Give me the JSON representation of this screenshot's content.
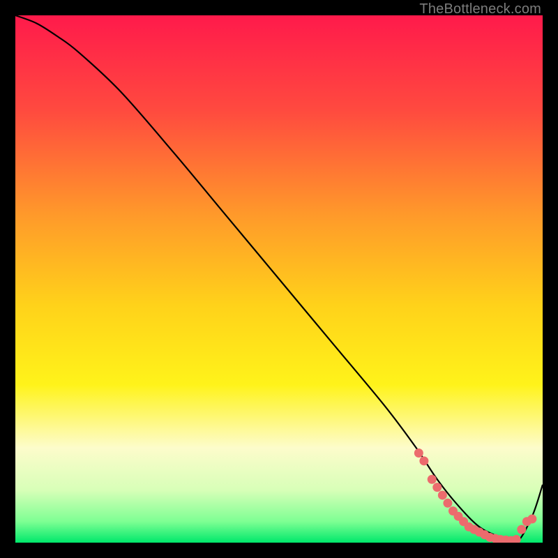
{
  "attribution": "TheBottleneck.com",
  "chart_data": {
    "type": "line",
    "xlim": [
      0,
      100
    ],
    "ylim": [
      0,
      100
    ],
    "grid": false,
    "background": "heatmap-gradient-vertical",
    "gradient_stops": [
      {
        "offset": 0,
        "color": "#ff1a4b"
      },
      {
        "offset": 18,
        "color": "#ff4a3f"
      },
      {
        "offset": 38,
        "color": "#ff9a2a"
      },
      {
        "offset": 55,
        "color": "#ffd21a"
      },
      {
        "offset": 70,
        "color": "#fff31a"
      },
      {
        "offset": 82,
        "color": "#fdfccb"
      },
      {
        "offset": 90,
        "color": "#d8ffb8"
      },
      {
        "offset": 96,
        "color": "#7dff93"
      },
      {
        "offset": 100,
        "color": "#00e86b"
      }
    ],
    "series": [
      {
        "name": "bottleneck-curve",
        "type": "line",
        "color": "#000000",
        "x": [
          0,
          4,
          8,
          12,
          20,
          30,
          40,
          50,
          60,
          70,
          76,
          80,
          84,
          88,
          92,
          95,
          98,
          100
        ],
        "y": [
          100,
          98.5,
          96,
          93,
          85.5,
          74,
          62,
          50,
          38,
          26,
          18,
          12,
          7,
          3,
          1,
          0,
          5,
          11
        ]
      },
      {
        "name": "highlight-markers",
        "type": "scatter",
        "color": "#EC6B6D",
        "x": [
          76.5,
          77.5,
          79,
          80,
          81,
          82,
          83,
          84,
          85,
          86,
          87,
          88,
          89,
          90,
          91,
          92,
          93,
          94,
          95,
          96,
          97,
          98
        ],
        "y": [
          17,
          15.5,
          12,
          10.5,
          9,
          7.5,
          6,
          5,
          4,
          3,
          2.5,
          2,
          1.5,
          1,
          0.8,
          0.6,
          0.5,
          0.4,
          0.6,
          2.5,
          4,
          4.5
        ]
      }
    ]
  }
}
